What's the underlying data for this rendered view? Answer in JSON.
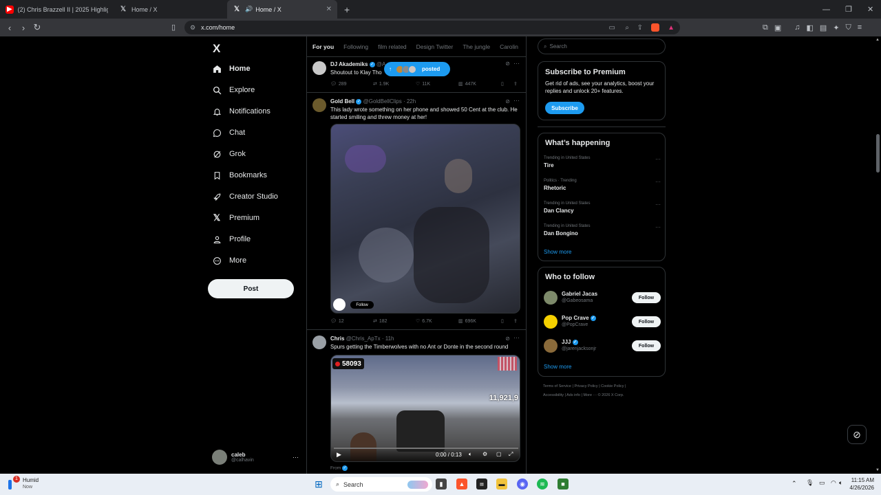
{
  "browser": {
    "tabs": [
      {
        "label": "(2) Chris Brazzell II | 2025 Highlights"
      },
      {
        "label": "Home / X"
      },
      {
        "label": "Home / X"
      }
    ],
    "url": "x.com/home"
  },
  "nav": {
    "logo": "X",
    "items": [
      {
        "label": "Home",
        "icon": "home-icon"
      },
      {
        "label": "Explore",
        "icon": "search-icon"
      },
      {
        "label": "Notifications",
        "icon": "bell-icon"
      },
      {
        "label": "Chat",
        "icon": "chat-icon"
      },
      {
        "label": "Grok",
        "icon": "grok-icon"
      },
      {
        "label": "Bookmarks",
        "icon": "bookmark-icon"
      },
      {
        "label": "Creator Studio",
        "icon": "rocket-icon"
      },
      {
        "label": "Premium",
        "icon": "x-icon"
      },
      {
        "label": "Profile",
        "icon": "person-icon"
      },
      {
        "label": "More",
        "icon": "more-circle-icon"
      }
    ],
    "post_label": "Post",
    "account": {
      "name": "caleb",
      "handle": "@calhavin"
    }
  },
  "feed": {
    "tabs": [
      "For you",
      "Following",
      "film related",
      "Design Twitter",
      "The jungle",
      "Carolin"
    ],
    "posted_pill": "posted",
    "tweets": [
      {
        "name": "DJ Akademiks",
        "handle": "@A",
        "text": "Shoutout to Klay Tho",
        "replies": "289",
        "reposts": "1.9K",
        "likes": "11K",
        "views": "447K"
      },
      {
        "name": "Gold Bell",
        "handle": "@GoldBellClips · 22h",
        "text": "This lady wrote something on her phone and showed 50 Cent at the club. He started smiling and threw money at her!",
        "media_follow": "Follow",
        "replies": "12",
        "reposts": "182",
        "likes": "6.7K",
        "views": "696K"
      },
      {
        "name": "Chris",
        "handle": "@Chris_ApTx · 11h",
        "text": "Spurs getting the Timberwolves with no Ant or Donte in the second round",
        "video_counter": "58093",
        "video_overlay": "11,921,9",
        "video_time": "0:00 / 0:13",
        "from_label": "From"
      }
    ]
  },
  "sidebar": {
    "search_placeholder": "Search",
    "premium": {
      "title": "Subscribe to Premium",
      "body": "Get rid of ads, see your analytics, boost your replies and unlock 20+ features.",
      "button": "Subscribe"
    },
    "happening": {
      "title": "What’s happening",
      "trends": [
        {
          "meta": "Trending in United States",
          "name": "Tire"
        },
        {
          "meta": "Politics · Trending",
          "name": "Rhetoric"
        },
        {
          "meta": "Trending in United States",
          "name": "Dan Clancy"
        },
        {
          "meta": "Trending in United States",
          "name": "Dan Bongino"
        }
      ],
      "show_more": "Show more"
    },
    "who_to_follow": {
      "title": "Who to follow",
      "accounts": [
        {
          "name": "Gabriel Jacas",
          "handle": "@Gabeosama",
          "button": "Follow"
        },
        {
          "name": "Pop Crave",
          "handle": "@PopCrave",
          "button": "Follow"
        },
        {
          "name": "JJJ",
          "handle": "@jarenjacksonjr",
          "button": "Follow"
        }
      ],
      "show_more": "Show more"
    },
    "footer": {
      "line1": "Terms of Service  |  Privacy Policy  |  Cookie Policy  |",
      "line2": "Accessibility  |  Ads info  |  More ···  © 2026 X Corp."
    }
  },
  "taskbar": {
    "weather": "Humid",
    "weather_sub": "Now",
    "badge": "1",
    "search_placeholder": "Search",
    "time": "11:15 AM",
    "date": "4/26/2026"
  },
  "colors": {
    "accent": "#1d9bf0",
    "background": "#000000",
    "border": "#2f3336"
  }
}
